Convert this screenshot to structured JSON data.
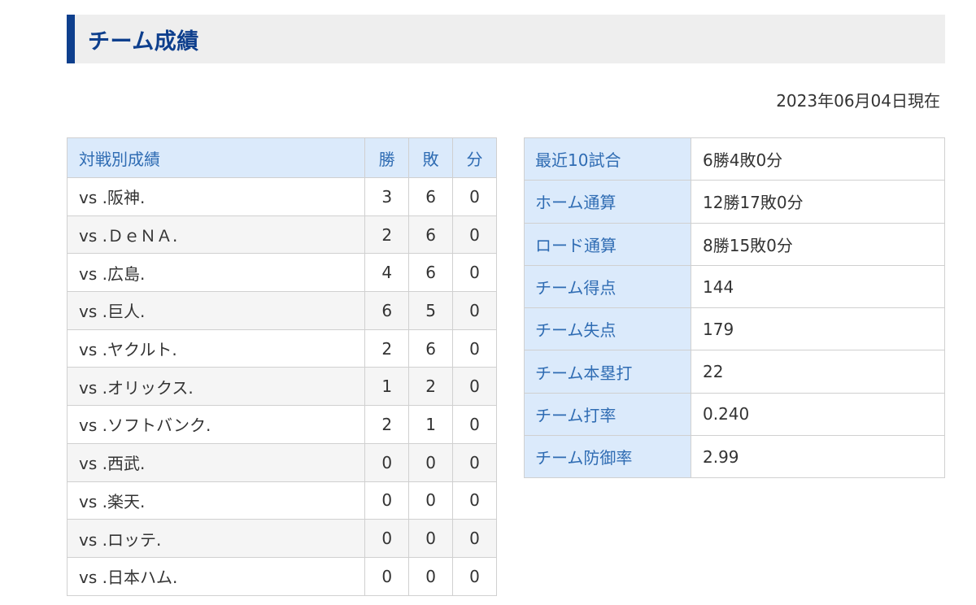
{
  "title": "チーム成績",
  "as_of": "2023年06月04日現在",
  "matchups": {
    "headers": [
      "対戦別成績",
      "勝",
      "敗",
      "分"
    ],
    "rows": [
      {
        "opponent": "vs .阪神.",
        "w": "3",
        "l": "6",
        "d": "0"
      },
      {
        "opponent": "vs .ＤｅＮＡ.",
        "w": "2",
        "l": "6",
        "d": "0"
      },
      {
        "opponent": "vs .広島.",
        "w": "4",
        "l": "6",
        "d": "0"
      },
      {
        "opponent": "vs .巨人.",
        "w": "6",
        "l": "5",
        "d": "0"
      },
      {
        "opponent": "vs .ヤクルト.",
        "w": "2",
        "l": "6",
        "d": "0"
      },
      {
        "opponent": "vs .オリックス.",
        "w": "1",
        "l": "2",
        "d": "0"
      },
      {
        "opponent": "vs .ソフトバンク.",
        "w": "2",
        "l": "1",
        "d": "0"
      },
      {
        "opponent": "vs .西武.",
        "w": "0",
        "l": "0",
        "d": "0"
      },
      {
        "opponent": "vs .楽天.",
        "w": "0",
        "l": "0",
        "d": "0"
      },
      {
        "opponent": "vs .ロッテ.",
        "w": "0",
        "l": "0",
        "d": "0"
      },
      {
        "opponent": "vs .日本ハム.",
        "w": "0",
        "l": "0",
        "d": "0"
      }
    ]
  },
  "stats": [
    {
      "label": "最近10試合",
      "value": "6勝4敗0分"
    },
    {
      "label": "ホーム通算",
      "value": "12勝17敗0分"
    },
    {
      "label": "ロード通算",
      "value": "8勝15敗0分"
    },
    {
      "label": "チーム得点",
      "value": "144"
    },
    {
      "label": "チーム失点",
      "value": "179"
    },
    {
      "label": "チーム本塁打",
      "value": "22"
    },
    {
      "label": "チーム打率",
      "value": "0.240"
    },
    {
      "label": "チーム防御率",
      "value": "2.99"
    }
  ],
  "colors": {
    "accent": "#0e3f8d",
    "header_bg": "#dbeafb",
    "header_text": "#2f6cb3"
  }
}
